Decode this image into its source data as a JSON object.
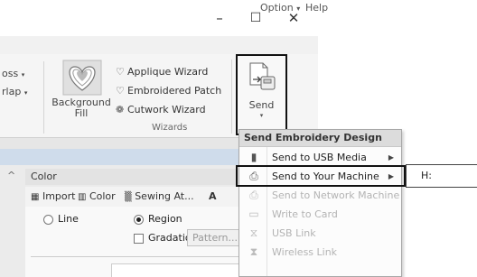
{
  "window": {
    "minimize_icon": "minimize-icon",
    "maximize_icon": "maximize-icon",
    "close_icon": "close-icon"
  },
  "menubar": {
    "option": "Option",
    "help": "Help"
  },
  "ribbon": {
    "left_items": [
      "oss",
      "rlap"
    ],
    "background_fill": {
      "line1": "Background",
      "line2": "Fill"
    },
    "wizards": {
      "items": [
        {
          "label": "Applique Wizard",
          "icon": "heart-outline-icon"
        },
        {
          "label": "Embroidered Patch",
          "icon": "heart-outline-icon"
        },
        {
          "label": "Cutwork Wizard",
          "icon": "cutwork-icon"
        }
      ],
      "group_label": "Wizards"
    },
    "send": {
      "label": "Send"
    }
  },
  "panel": {
    "header": "Color",
    "tabs": [
      {
        "label": "Import",
        "icon": "import-icon"
      },
      {
        "label": "Color",
        "icon": "color-icon"
      },
      {
        "label": "Sewing At...",
        "icon": "sewing-icon"
      }
    ],
    "tab_more": "A",
    "radio_line": "Line",
    "radio_region": "Region",
    "checkbox_gradation": "Gradation",
    "pattern_button": "Pattern..."
  },
  "dropdown": {
    "header": "Send Embroidery Design",
    "items": [
      {
        "label": "Send to USB Media",
        "icon": "usb-icon",
        "enabled": true,
        "submenu": true
      },
      {
        "label": "Send to Your Machine",
        "icon": "machine-icon",
        "enabled": true,
        "submenu": true
      },
      {
        "label": "Send to Network Machine",
        "icon": "network-icon",
        "enabled": false,
        "submenu": false
      },
      {
        "label": "Write to Card",
        "icon": "card-icon",
        "enabled": false,
        "submenu": false
      },
      {
        "label": "USB Link",
        "icon": "link-icon",
        "enabled": false,
        "submenu": false
      },
      {
        "label": "Wireless Link",
        "icon": "wireless-icon",
        "enabled": false,
        "submenu": false
      }
    ]
  },
  "submenu": {
    "text": "H:"
  }
}
